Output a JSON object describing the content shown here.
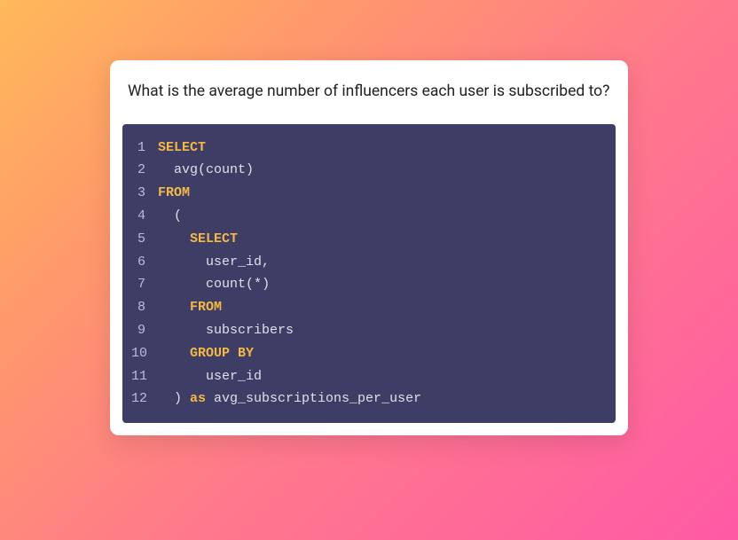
{
  "question": "What is the average number of influencers each user is subscribed to?",
  "code": {
    "colors": {
      "background": "#3d3d66",
      "keyword": "#f5b942",
      "text": "#e0e0e8",
      "gutter": "#bdbdd9"
    },
    "lines": [
      {
        "n": "1",
        "tokens": [
          {
            "t": "SELECT",
            "c": "kw"
          }
        ]
      },
      {
        "n": "2",
        "tokens": [
          {
            "t": "  avg",
            "c": "txt"
          },
          {
            "t": "(",
            "c": "txt"
          },
          {
            "t": "count",
            "c": "txt"
          },
          {
            "t": ")",
            "c": "txt"
          }
        ]
      },
      {
        "n": "3",
        "tokens": [
          {
            "t": "FROM",
            "c": "kw"
          }
        ]
      },
      {
        "n": "4",
        "tokens": [
          {
            "t": "  (",
            "c": "txt"
          }
        ]
      },
      {
        "n": "5",
        "tokens": [
          {
            "t": "    ",
            "c": "txt"
          },
          {
            "t": "SELECT",
            "c": "kw"
          }
        ]
      },
      {
        "n": "6",
        "tokens": [
          {
            "t": "      user_id,",
            "c": "txt"
          }
        ]
      },
      {
        "n": "7",
        "tokens": [
          {
            "t": "      count",
            "c": "txt"
          },
          {
            "t": "(",
            "c": "txt"
          },
          {
            "t": "*",
            "c": "txt"
          },
          {
            "t": ")",
            "c": "txt"
          }
        ]
      },
      {
        "n": "8",
        "tokens": [
          {
            "t": "    ",
            "c": "txt"
          },
          {
            "t": "FROM",
            "c": "kw"
          }
        ]
      },
      {
        "n": "9",
        "tokens": [
          {
            "t": "      subscribers",
            "c": "txt"
          }
        ]
      },
      {
        "n": "10",
        "tokens": [
          {
            "t": "    ",
            "c": "txt"
          },
          {
            "t": "GROUP BY",
            "c": "kw"
          }
        ]
      },
      {
        "n": "11",
        "tokens": [
          {
            "t": "      user_id",
            "c": "txt"
          }
        ]
      },
      {
        "n": "12",
        "tokens": [
          {
            "t": "  ) ",
            "c": "txt"
          },
          {
            "t": "as",
            "c": "kw2"
          },
          {
            "t": " avg_subscriptions_per_user",
            "c": "txt"
          }
        ]
      }
    ]
  }
}
